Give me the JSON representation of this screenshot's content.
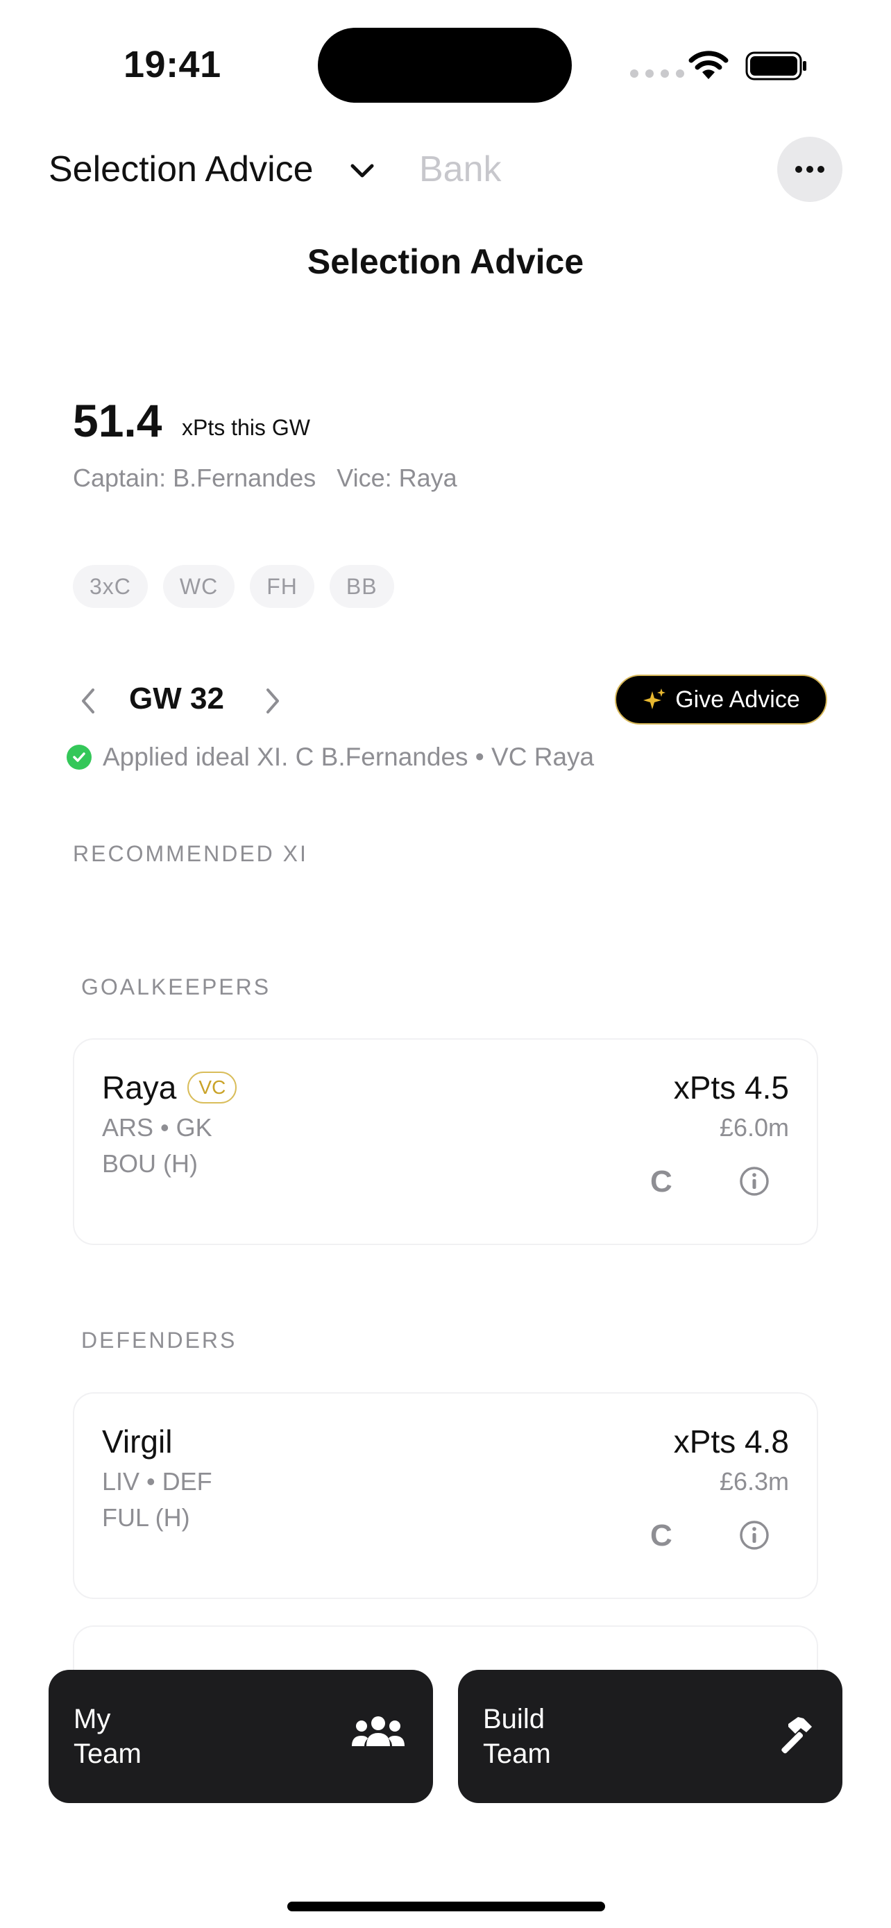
{
  "status_bar": {
    "time": "19:41"
  },
  "nav": {
    "title": "Selection Advice",
    "bank_label": "Bank"
  },
  "page": {
    "title": "Selection Advice"
  },
  "summary": {
    "xpts": "51.4",
    "xpts_label": "xPts this GW",
    "captain_line": "Captain: B.Fernandes",
    "vice_line": "Vice: Raya",
    "chips": [
      "3xC",
      "WC",
      "FH",
      "BB"
    ]
  },
  "gameweek": {
    "label": "GW 32",
    "advice_button": "Give Advice",
    "applied_text": "Applied ideal XI. C B.Fernandes • VC Raya"
  },
  "sections": {
    "recommended": "RECOMMENDED XI",
    "goalkeepers": "GOALKEEPERS",
    "defenders": "DEFENDERS"
  },
  "players": [
    {
      "name": "Raya",
      "badge": "VC",
      "meta": "ARS • GK",
      "fixture": "BOU (H)",
      "xpts": "xPts 4.5",
      "price": "£6.0m",
      "captain_btn": "C"
    },
    {
      "name": "Virgil",
      "badge": "",
      "meta": "LIV • DEF",
      "fixture": "FUL (H)",
      "xpts": "xPts 4.8",
      "price": "£6.3m",
      "captain_btn": "C"
    }
  ],
  "bottom": {
    "my_team_line1": "My",
    "my_team_line2": "Team",
    "build_team_line1": "Build",
    "build_team_line2": "Team"
  },
  "colors": {
    "accent_gold": "#d7b85a",
    "success": "#34c759",
    "dark_button": "#1c1c1e"
  }
}
